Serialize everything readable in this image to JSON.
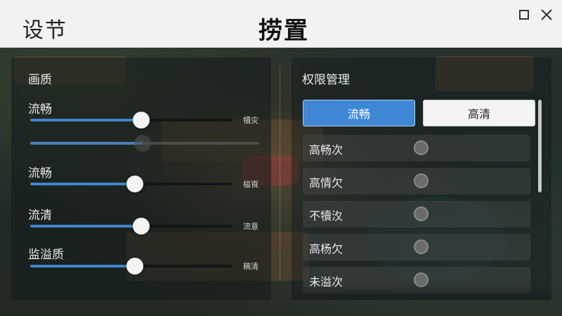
{
  "header": {
    "title_left": "设节",
    "title_center": "捞置"
  },
  "icons": {
    "maximize": "maximize-icon",
    "close": "close-icon"
  },
  "colors": {
    "accent": "#3f84c9",
    "header_bg": "#f2f2f2",
    "active_button": "#3f86d4"
  },
  "left_panel": {
    "section_title": "画质",
    "sliders": [
      {
        "label": "流畅",
        "end_label": "犢灾",
        "value": 0.55
      },
      {
        "label": "",
        "end_label": "",
        "value": 0.49,
        "secondary": true
      },
      {
        "label": "流畅",
        "end_label": "榏崀",
        "value": 0.52
      },
      {
        "label": "流清",
        "end_label": "流意",
        "value": 0.55
      },
      {
        "label": "监溢质",
        "end_label": "稿清",
        "value": 0.52
      }
    ]
  },
  "right_panel": {
    "section_title": "权限管理",
    "mode_buttons": [
      {
        "label": "流畅",
        "active": true
      },
      {
        "label": "高清",
        "active": false
      }
    ],
    "options": [
      {
        "label": "高畅次"
      },
      {
        "label": "高情欠"
      },
      {
        "label": "不犢汷"
      },
      {
        "label": "高杨欠"
      },
      {
        "label": "未溢次"
      }
    ]
  }
}
